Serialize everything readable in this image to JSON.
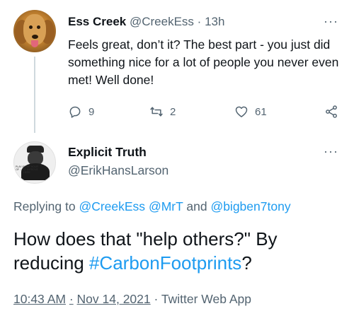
{
  "tweet": {
    "author_name": "Ess Creek",
    "author_handle": "@CreekEss",
    "separator": "·",
    "time_ago": "13h",
    "text": "Feels great, don’t it? The best part - you just did something nice for a lot of people you never even met! Well done!",
    "replies": "9",
    "retweets": "2",
    "likes": "61",
    "more_menu": "···"
  },
  "reply": {
    "author_name": "Explicit Truth",
    "author_handle": "@ErikHansLarson",
    "more_menu": "···",
    "avatar_caption": "PLAY IS THE HOUR OF ... TO IMPROVE HERE",
    "replying_prefix": "Replying to",
    "replying_to": [
      "@CreekEss",
      "@MrT",
      "@bigben7tony"
    ],
    "replying_and": "and",
    "text_before": "How does that \"help others?\" By reducing ",
    "hashtag": "#CarbonFootprints",
    "text_after": "?",
    "time": "10:43 AM",
    "dot": "·",
    "date": "Nov 14, 2021",
    "source": "Twitter Web App"
  },
  "colors": {
    "text": "#0f1419",
    "muted": "#536471",
    "link": "#1d9bf0",
    "thread_line": "#cfd9de"
  },
  "icons": {
    "reply": "reply-icon",
    "retweet": "retweet-icon",
    "like": "heart-icon",
    "share": "share-icon",
    "more": "more-icon"
  }
}
